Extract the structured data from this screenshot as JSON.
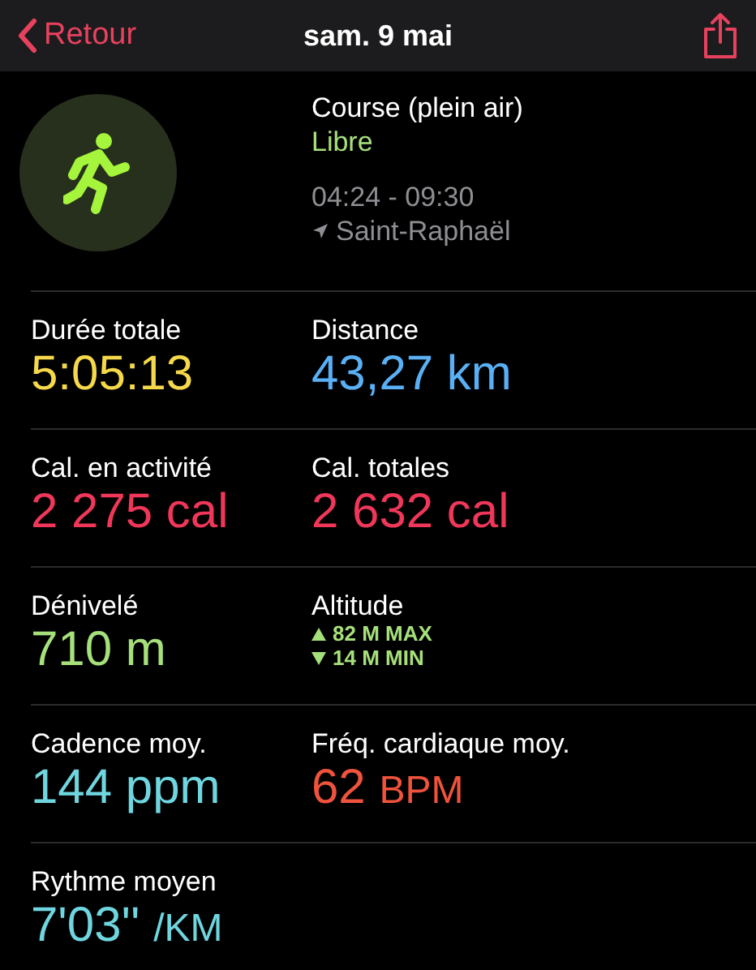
{
  "nav": {
    "back": "Retour",
    "title": "sam. 9 mai"
  },
  "workout": {
    "name": "Course (plein air)",
    "type": "Libre",
    "time": "04:24 - 09:30",
    "location": "Saint-Raphaël"
  },
  "metric_rows": [
    [
      {
        "kind": "value",
        "label": "Durée totale",
        "value": "5:05:13",
        "color": "#f5d94a"
      },
      {
        "kind": "value",
        "label": "Distance",
        "value": "43,27 km",
        "color": "#5ab0f5"
      }
    ],
    [
      {
        "kind": "value",
        "label": "Cal. en activité",
        "value": "2 275 cal",
        "color": "#f0375a"
      },
      {
        "kind": "value",
        "label": "Cal. totales",
        "value": "2 632 cal",
        "color": "#f0375a"
      }
    ],
    [
      {
        "kind": "value",
        "label": "Dénivelé",
        "value": "710 m",
        "color": "#a6e07a"
      },
      {
        "kind": "range",
        "label": "Altitude",
        "max": "82 M MAX",
        "min": "14 M MIN",
        "color": "#a6e07a"
      }
    ],
    [
      {
        "kind": "value",
        "label": "Cadence moy.",
        "value": "144 ppm",
        "color": "#6fd6e0"
      },
      {
        "kind": "value",
        "label": "Fréq. cardiaque moy.",
        "value": "62",
        "unit": "BPM",
        "color": "#f0533c"
      }
    ],
    [
      {
        "kind": "value",
        "label": "Rythme moyen",
        "value": "7'03''",
        "unit": "/KM",
        "color": "#6fd6e0"
      }
    ]
  ]
}
